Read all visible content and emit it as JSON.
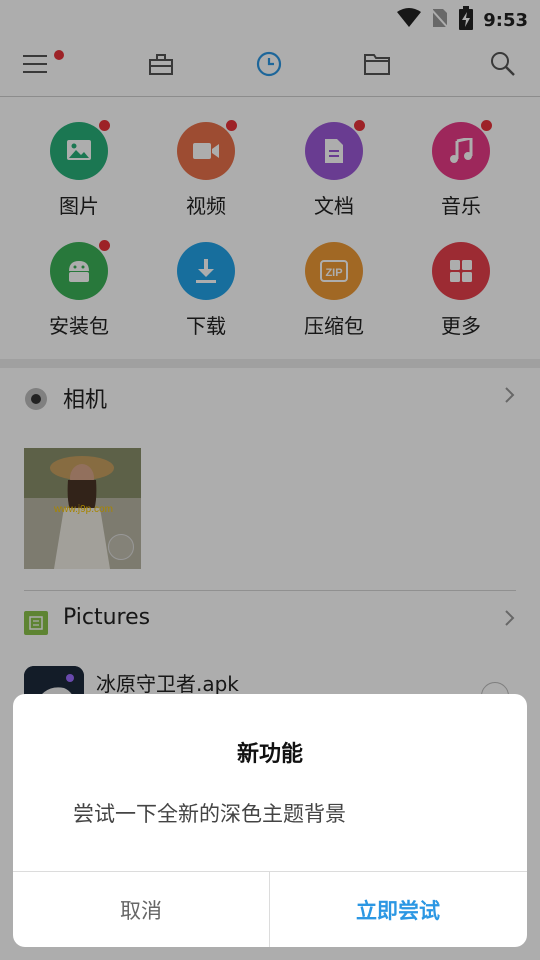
{
  "status": {
    "time": "9:53"
  },
  "appbar": {
    "icons": [
      "menu-icon",
      "toolbox-icon",
      "recent-clock-icon",
      "folder-icon",
      "search-icon"
    ],
    "accent": "#2b97e3"
  },
  "categories": [
    {
      "label": "图片",
      "icon": "image-icon",
      "color": "#28b07a",
      "badge": true
    },
    {
      "label": "视频",
      "icon": "video-icon",
      "color": "#e8704a",
      "badge": true
    },
    {
      "label": "文档",
      "icon": "document-icon",
      "color": "#9b59d6",
      "badge": true
    },
    {
      "label": "音乐",
      "icon": "music-icon",
      "color": "#e83a86",
      "badge": true
    },
    {
      "label": "安装包",
      "icon": "android-icon",
      "color": "#3bb257",
      "badge": true
    },
    {
      "label": "下载",
      "icon": "download-icon",
      "color": "#23a3e8",
      "badge": false
    },
    {
      "label": "压缩包",
      "icon": "zip-icon",
      "color": "#ee9a35",
      "badge": false
    },
    {
      "label": "更多",
      "icon": "more-grid-icon",
      "color": "#e6404c",
      "badge": false
    }
  ],
  "sections": {
    "camera": {
      "title": "相机"
    },
    "pictures": {
      "title": "Pictures"
    }
  },
  "photo": {
    "watermark": "www.j9p.com"
  },
  "apk": {
    "name": "冰原守卫者.apk"
  },
  "dialog": {
    "title": "新功能",
    "message": "尝试一下全新的深色主题背景",
    "cancel": "取消",
    "confirm": "立即尝试"
  }
}
